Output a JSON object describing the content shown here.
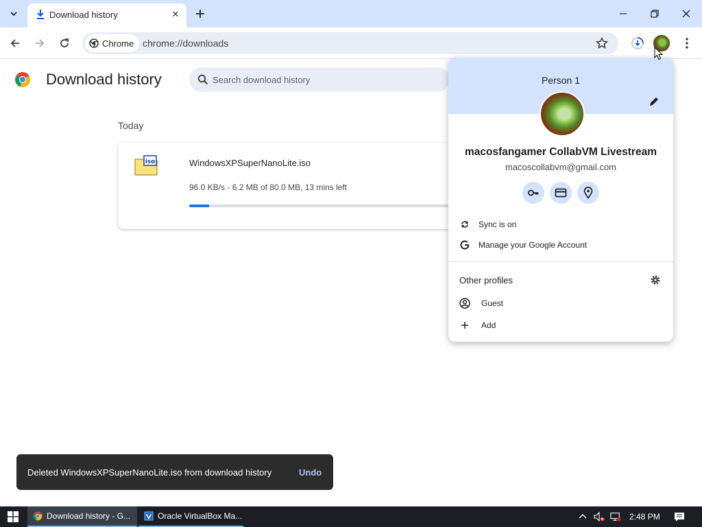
{
  "tab": {
    "title": "Download history",
    "close_glyph": "✕",
    "new_tab_glyph": "+"
  },
  "toolbar": {
    "chip_label": "Chrome",
    "url": "chrome://downloads"
  },
  "page": {
    "title": "Download history",
    "search_placeholder": "Search download history",
    "section_label": "Today"
  },
  "download": {
    "file_name": "WindowsXPSuperNanoLite.iso",
    "status": "96.0 KB/s - 6.2 MB of 80.0 MB, 13 mins left",
    "progress_fraction": 0.0775
  },
  "profile_menu": {
    "title": "Person 1",
    "name": "macosfangamer CollabVM Livestream",
    "email": "macoscollabvm@gmail.com",
    "quick_actions": [
      "key-icon",
      "credit-card-icon",
      "location-pin-icon"
    ],
    "sync_label": "Sync is on",
    "manage_label": "Manage your Google Account",
    "other_profiles_label": "Other profiles",
    "guest_label": "Guest",
    "add_label": "Add"
  },
  "snackbar": {
    "message": "Deleted WindowsXPSuperNanoLite.iso from download history",
    "action": "Undo"
  },
  "taskbar": {
    "items": [
      {
        "label": "Download history - G..."
      },
      {
        "label": "Oracle VirtualBox Ma..."
      }
    ],
    "clock": "2:48 PM"
  },
  "colors": {
    "accent": "#1a73e8",
    "tabstrip": "#d3e3fd",
    "snackbar_bg": "#2c2c2c",
    "undo": "#a8c7fa",
    "taskbar": "#1b1f24"
  }
}
